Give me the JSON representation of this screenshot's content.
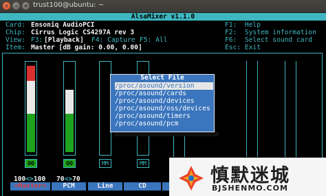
{
  "window": {
    "title": "trust100@ubuntu: ~"
  },
  "app": {
    "title": "AlsaMixer v1.1.0"
  },
  "info": {
    "card_label": "Card:",
    "card_value": "Ensoniq AudioPCI",
    "chip_label": "Chip:",
    "chip_value": "Cirrus Logic CS4297A rev 3",
    "view_label": "View:",
    "view_f3": "F3:",
    "view_playback": "[Playback]",
    "view_f4": "F4: Capture",
    "view_f5": "F5: All",
    "item_label": "Item:",
    "item_value": "Master [dB gain: 0.00, 0.00]"
  },
  "help": {
    "f1": "F1:  Help",
    "f2": "F2:  System information",
    "f6": "F6:  Select sound card",
    "esc": "Esc: Exit"
  },
  "channels": [
    {
      "name": "Master",
      "vol_left": "100",
      "vol_right": "100",
      "arrows": "<>",
      "state": "OO",
      "selected": true,
      "level": 1.0
    },
    {
      "name": "PCM",
      "vol_left": "70",
      "vol_right": "70",
      "arrows": "<>",
      "state": "OO",
      "selected": false,
      "level": 0.7
    },
    {
      "name": "Line",
      "state": "MM",
      "selected": false
    },
    {
      "name": "CD",
      "state": "MM",
      "selected": false
    }
  ],
  "dialog": {
    "title": "Select File",
    "options": [
      "/proc/asound/version",
      "/proc/asound/cards",
      "/proc/asound/devices",
      "/proc/asound/oss/devices",
      "/proc/asound/timers",
      "/proc/asound/pcm"
    ],
    "selected_index": 0
  },
  "colors": {
    "terminal_bg": "#000000",
    "accent_cyan": "#3fb7c0",
    "dialog_blue": "#3a75bd",
    "meter_green": "#1fa31f",
    "meter_red": "#d93030",
    "meter_white": "#e8e8e8"
  },
  "watermark": {
    "main": "慎默迷城",
    "sub": "BJSHENMO.COM"
  }
}
